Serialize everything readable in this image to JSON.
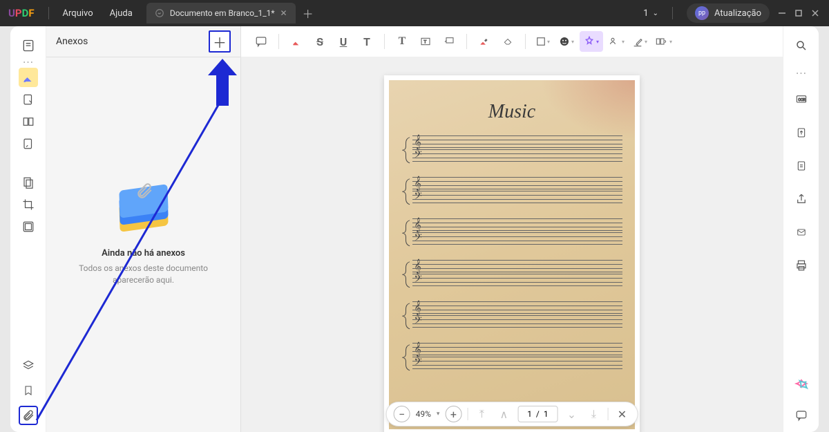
{
  "menu": {
    "arquivo": "Arquivo",
    "ajuda": "Ajuda"
  },
  "tab": {
    "title": "Documento em Branco_1_1*"
  },
  "titlebar": {
    "pageNum": "1",
    "update": "Atualização",
    "avatar": "pp"
  },
  "panel": {
    "title": "Anexos",
    "emptyTitle": "Ainda não há anexos",
    "emptySub": "Todos os anexos deste documento aparecerão aqui."
  },
  "doc": {
    "title": "Music"
  },
  "pager": {
    "zoom": "49%",
    "page": "1  /  1"
  }
}
